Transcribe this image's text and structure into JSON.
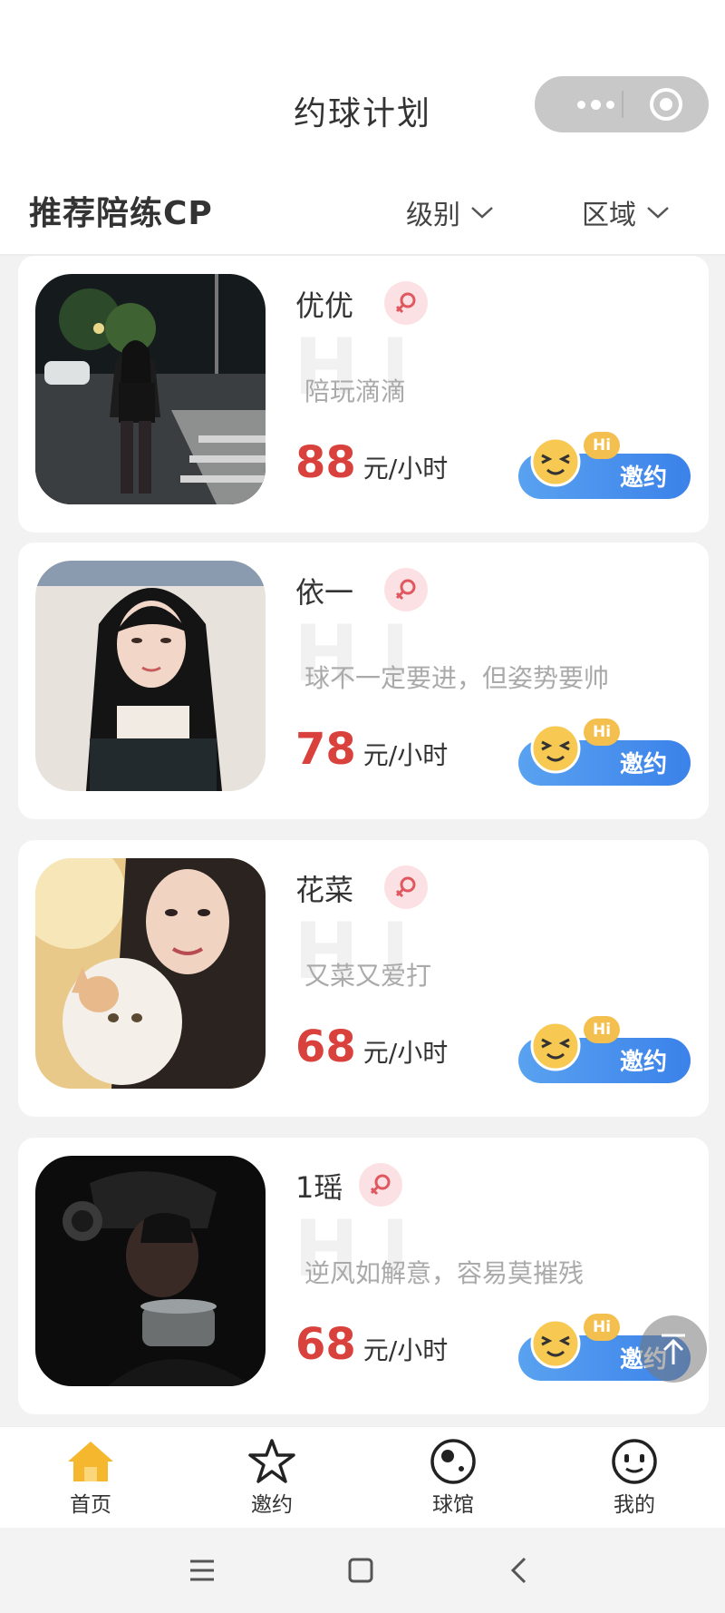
{
  "header": {
    "title": "约球计划"
  },
  "filter_bar": {
    "section_title": "推荐陪练CP",
    "level_label": "级别",
    "region_label": "区域"
  },
  "players": [
    {
      "name": "优优",
      "motto": "陪玩滴滴",
      "price": "88",
      "unit": "元/小时",
      "invite_label": "邀约",
      "hi_badge": "Hi",
      "watermark": "HI",
      "gender_icon": "female-icon",
      "gender_color": "#e0585f"
    },
    {
      "name": "依一",
      "motto": "球不一定要进，但姿势要帅",
      "price": "78",
      "unit": "元/小时",
      "invite_label": "邀约",
      "hi_badge": "Hi",
      "watermark": "HI",
      "gender_icon": "female-icon",
      "gender_color": "#e0585f"
    },
    {
      "name": "花菜",
      "motto": "又菜又爱打",
      "price": "68",
      "unit": "元/小时",
      "invite_label": "邀约",
      "hi_badge": "Hi",
      "watermark": "HI",
      "gender_icon": "female-icon",
      "gender_color": "#e0585f"
    },
    {
      "name": "1瑶",
      "motto": "逆风如解意，容易莫摧残",
      "price": "68",
      "unit": "元/小时",
      "invite_label": "邀约",
      "hi_badge": "Hi",
      "watermark": "HI",
      "gender_icon": "female-icon",
      "gender_color": "#e0585f"
    }
  ],
  "tabs": [
    {
      "label": "首页",
      "icon": "home-icon",
      "active": true
    },
    {
      "label": "邀约",
      "icon": "star-icon",
      "active": false
    },
    {
      "label": "球馆",
      "icon": "ball-icon",
      "active": false
    },
    {
      "label": "我的",
      "icon": "smiley-icon",
      "active": false
    }
  ],
  "colors": {
    "accent": "#3b82ea",
    "price": "#d9413c",
    "active_tab": "#f5b72e"
  }
}
